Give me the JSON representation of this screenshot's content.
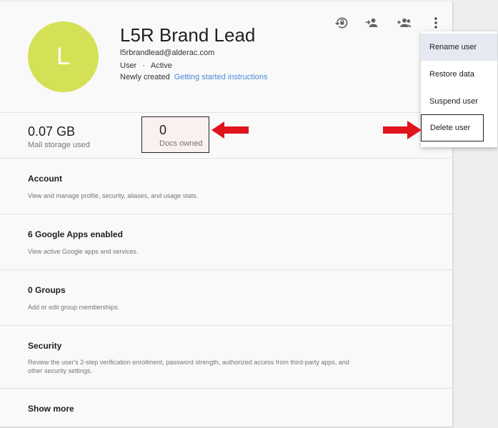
{
  "user": {
    "avatar_initial": "L",
    "name": "L5R Brand Lead",
    "email": "l5rbrandlead@alderac.com",
    "role": "User",
    "status": "Active",
    "created": "Newly created",
    "getting_started_link": "Getting started instructions",
    "avatar_color": "#d4e157"
  },
  "stats": {
    "storage_value": "0.07 GB",
    "storage_label": "Mail storage used",
    "docs_value": "0",
    "docs_label": "Docs owned"
  },
  "sections": [
    {
      "title": "Account",
      "description": "View and manage profile, security, aliases, and usage stats."
    },
    {
      "title": "6 Google Apps enabled",
      "description": "View active Google apps and services."
    },
    {
      "title": "0 Groups",
      "description": "Add or edit group memberships."
    },
    {
      "title": "Security",
      "description": "Review the user's 2-step verification enrollment, password strength, authorized access from third-party apps, and other security settings."
    },
    {
      "title": "Show more",
      "description": ""
    }
  ],
  "menu": {
    "items": [
      "Rename user",
      "Restore data",
      "Suspend user",
      "Delete user"
    ]
  },
  "toolbar": {
    "icons": [
      "restore-icon",
      "transfer-user-icon",
      "add-to-group-icon",
      "more-vert-icon"
    ]
  },
  "colors": {
    "link": "#4a8ad8",
    "arrow": "#e0141c",
    "menu_highlight": "#e6e9f2"
  }
}
